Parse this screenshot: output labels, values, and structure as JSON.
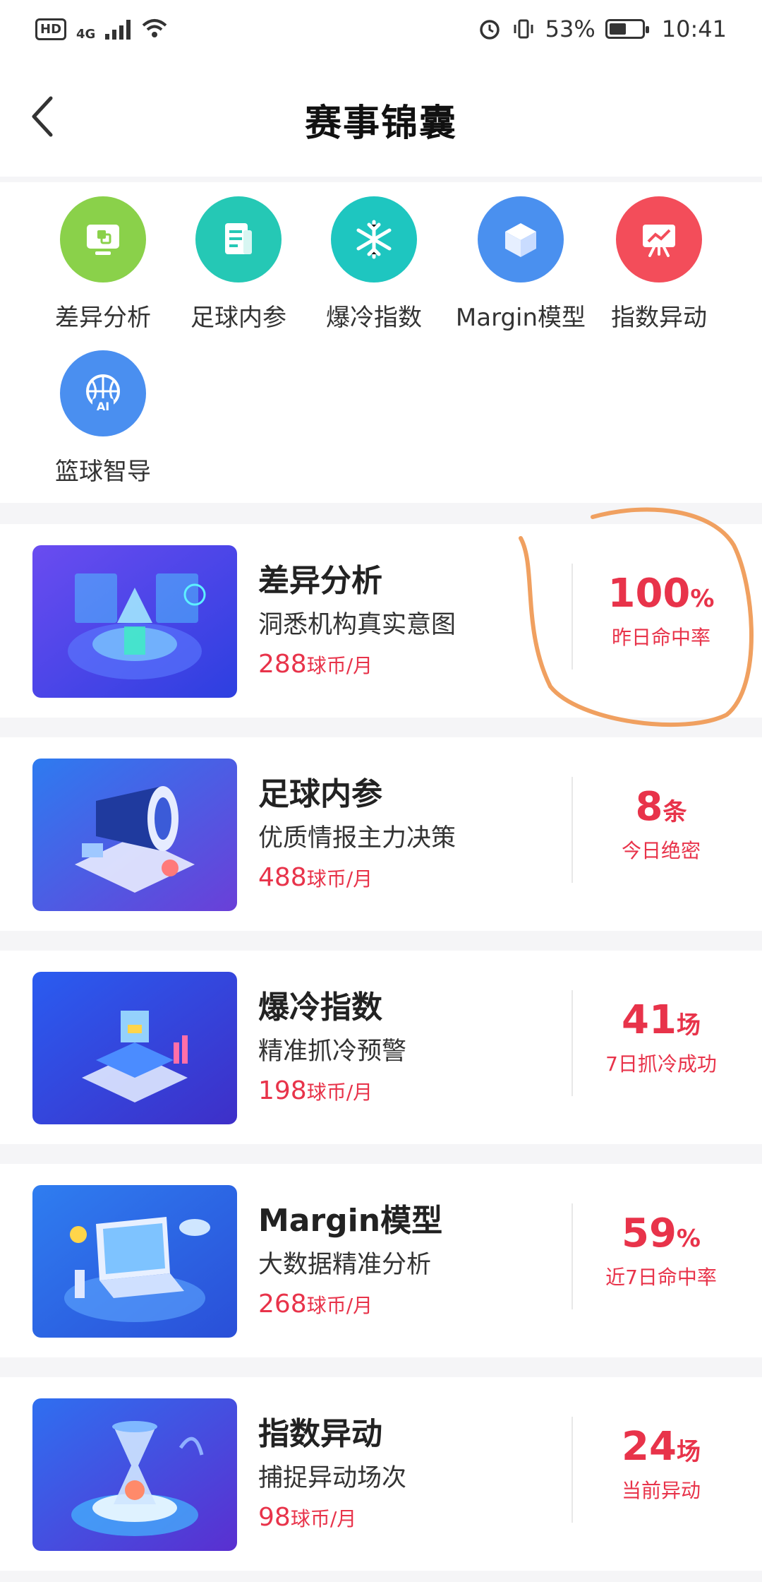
{
  "status_bar": {
    "hd": "HD",
    "network": "4G",
    "battery": "53%",
    "time": "10:41",
    "battery_level": 0.53
  },
  "header": {
    "title": "赛事锦囊"
  },
  "grid": {
    "items": [
      {
        "label": "差异分析",
        "icon": "monitor-icon",
        "color": "#8ad14a"
      },
      {
        "label": "足球内参",
        "icon": "document-icon",
        "color": "#25c8b5"
      },
      {
        "label": "爆冷指数",
        "icon": "snowflake-icon",
        "color": "#1ec6c0"
      },
      {
        "label": "Margin模型",
        "icon": "cube-icon",
        "color": "#4a90ef"
      },
      {
        "label": "指数异动",
        "icon": "chart-board-icon",
        "color": "#f34d5a"
      },
      {
        "label": "篮球智导",
        "icon": "basketball-ai-icon",
        "color": "#4a8ff0",
        "badge": "AI"
      }
    ]
  },
  "cards": [
    {
      "title": "差异分析",
      "subtitle": "洞悉机构真实意图",
      "price": "288",
      "unit": "球币/月",
      "stat_value": "100",
      "stat_unit": "%",
      "stat_desc": "昨日命中率"
    },
    {
      "title": "足球内参",
      "subtitle": "优质情报主力决策",
      "price": "488",
      "unit": "球币/月",
      "stat_value": "8",
      "stat_unit": "条",
      "stat_desc": "今日绝密"
    },
    {
      "title": "爆冷指数",
      "subtitle": "精准抓冷预警",
      "price": "198",
      "unit": "球币/月",
      "stat_value": "41",
      "stat_unit": "场",
      "stat_desc": "7日抓冷成功"
    },
    {
      "title": "Margin模型",
      "subtitle": "大数据精准分析",
      "price": "268",
      "unit": "球币/月",
      "stat_value": "59",
      "stat_unit": "%",
      "stat_desc": "近7日命中率"
    },
    {
      "title": "指数异动",
      "subtitle": "捕捉异动场次",
      "price": "98",
      "unit": "球币/月",
      "stat_value": "24",
      "stat_unit": "场",
      "stat_desc": "当前异动"
    }
  ],
  "colors": {
    "accent_red": "#e8334a",
    "annotation_orange": "#f0a060"
  }
}
